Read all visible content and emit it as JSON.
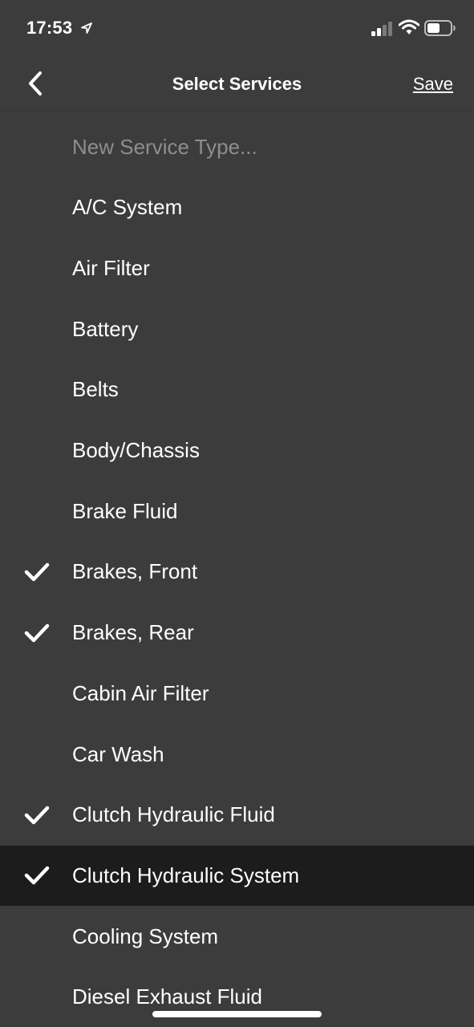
{
  "status_bar": {
    "time": "17:53"
  },
  "nav": {
    "title": "Select Services",
    "save_label": "Save"
  },
  "list": {
    "new_item_placeholder": "New Service Type...",
    "items": [
      {
        "label": "A/C System",
        "checked": false
      },
      {
        "label": "Air Filter",
        "checked": false
      },
      {
        "label": "Battery",
        "checked": false
      },
      {
        "label": "Belts",
        "checked": false
      },
      {
        "label": "Body/Chassis",
        "checked": false
      },
      {
        "label": "Brake Fluid",
        "checked": false
      },
      {
        "label": "Brakes, Front",
        "checked": true
      },
      {
        "label": "Brakes, Rear",
        "checked": true
      },
      {
        "label": "Cabin Air Filter",
        "checked": false
      },
      {
        "label": "Car Wash",
        "checked": false
      },
      {
        "label": "Clutch Hydraulic Fluid",
        "checked": true
      },
      {
        "label": "Clutch Hydraulic System",
        "checked": true,
        "highlighted": true
      },
      {
        "label": "Cooling System",
        "checked": false
      },
      {
        "label": "Diesel Exhaust Fluid",
        "checked": false
      }
    ]
  },
  "colors": {
    "background": "#3c3c3c",
    "highlight_row": "#1c1c1c",
    "placeholder_text": "#8e8e8e",
    "text": "#ffffff"
  },
  "icons": {
    "back": "chevron-left-icon",
    "check": "checkmark-icon",
    "location": "location-arrow-icon",
    "signal": "cellular-signal-icon",
    "wifi": "wifi-icon",
    "battery": "battery-icon"
  }
}
